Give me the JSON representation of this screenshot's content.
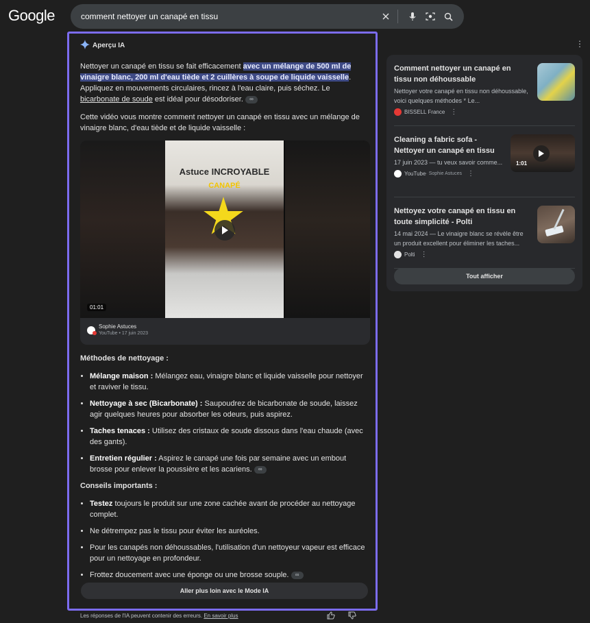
{
  "logo": "Google",
  "search": {
    "query": "comment nettoyer un canapé en tissu"
  },
  "ai_overview": {
    "title": "Aperçu IA",
    "intro_pre": "Nettoyer un canapé en tissu se fait efficacement ",
    "intro_highlight": "avec un mélange de 500 ml de vinaigre blanc, 200 ml d'eau tiède et 2 cuillères à soupe de liquide vaisselle",
    "intro_post": ". Appliquez en mouvements circulaires, rincez à l'eau claire, puis séchez. Le ",
    "intro_link": "bicarbonate de soude",
    "intro_end": " est idéal pour désodoriser.",
    "video_intro": "Cette vidéo vous montre comment nettoyer un canapé en tissu avec un mélange de vinaigre blanc, d'eau tiède et de liquide vaisselle :",
    "video": {
      "overlay_line1": "Astuce INCROYABLE",
      "overlay_line2": "CANAPÉ",
      "duration": "01:01",
      "channel": "Sophie Astuces",
      "source": "YouTube • 17 juin 2023"
    },
    "methods_title": "Méthodes de nettoyage :",
    "methods": [
      {
        "label": "Mélange maison :",
        "text": " Mélangez eau, vinaigre blanc et liquide vaisselle pour nettoyer et raviver le tissu."
      },
      {
        "label": "Nettoyage à sec (Bicarbonate) :",
        "text": " Saupoudrez de bicarbonate de soude, laissez agir quelques heures pour absorber les odeurs, puis aspirez."
      },
      {
        "label": "Taches tenaces :",
        "text": " Utilisez des cristaux de soude dissous dans l'eau chaude (avec des gants)."
      },
      {
        "label": "Entretien régulier :",
        "text": " Aspirez le canapé une fois par semaine avec un embout brosse pour enlever la poussière et les acariens."
      }
    ],
    "tips_title": "Conseils importants :",
    "tips": [
      {
        "label": "Testez",
        "text": " toujours le produit sur une zone cachée avant de procéder au nettoyage complet."
      },
      {
        "label": "",
        "text": "Ne détrempez pas le tissu pour éviter les auréoles."
      },
      {
        "label": "",
        "text": "Pour les canapés non déhoussables, l'utilisation d'un nettoyeur vapeur est efficace pour un nettoyage en profondeur."
      },
      {
        "label": "",
        "text": "Frottez doucement avec une éponge ou une brosse souple."
      }
    ],
    "more_button": "Aller plus loin avec le Mode IA"
  },
  "disclaimer": {
    "text": "Les réponses de l'IA peuvent contenir des erreurs. ",
    "link": "En savoir plus"
  },
  "sources": {
    "cards": [
      {
        "title": "Comment nettoyer un canapé en tissu non déhoussable",
        "desc": "Nettoyer votre canapé en tissu non déhoussable, voici quelques méthodes * Le...",
        "source": "BISSELL France"
      },
      {
        "title": "Cleaning a fabric sofa - Nettoyer un canapé en tissu",
        "desc": "17 juin 2023 — tu veux savoir comme...",
        "source": "YouTube",
        "source_sub": " · Sophie Astuces",
        "duration": "1:01"
      },
      {
        "title": "Nettoyez votre canapé en tissu en toute simplicité - Polti",
        "desc": "14 mai 2024 — Le vinaigre blanc se révèle être un produit excellent pour éliminer les taches...",
        "source": "Polti"
      }
    ],
    "show_all": "Tout afficher"
  },
  "colors": {
    "accent_border": "#7c6cf0",
    "highlight": "#3e4a85"
  }
}
